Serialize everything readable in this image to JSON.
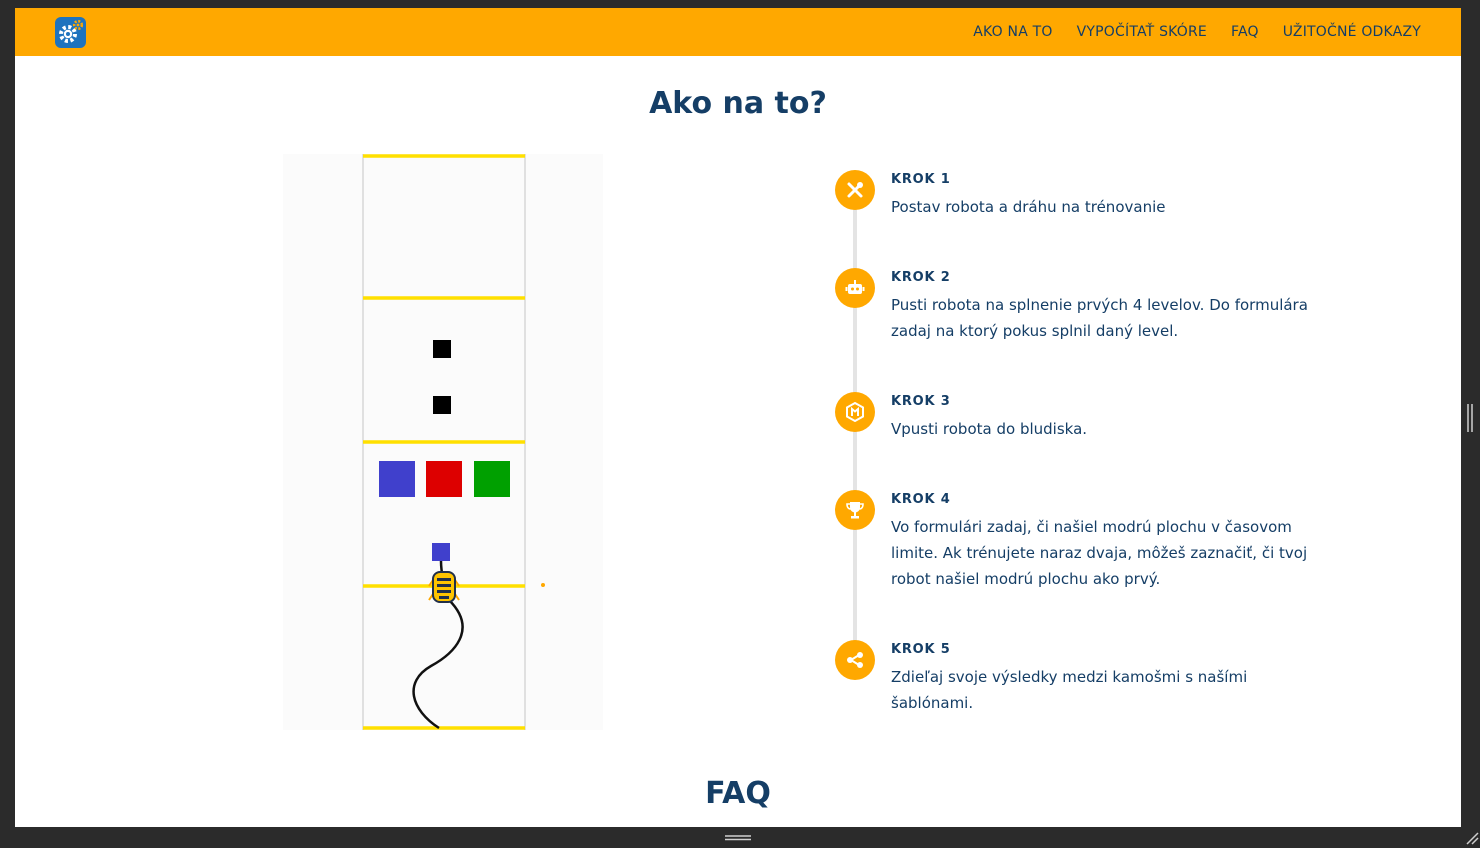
{
  "colors": {
    "navbar": "#ffa800",
    "text": "#153e66",
    "accent": "#ffa800",
    "track_line": "#ffe000",
    "block_blue": "#4040cc",
    "block_red": "#dd0000",
    "block_green": "#00a000",
    "obstacle": "#000000"
  },
  "navbar": {
    "logo_icon": "gears-icon",
    "links": [
      "AKO NA TO",
      "VYPOČÍTAŤ SKÓRE",
      "FAQ",
      "UŽITOČNÉ ODKAZY"
    ]
  },
  "main": {
    "title": "Ako na to?",
    "figure_icon": "robot-track-illustration",
    "steps": [
      {
        "icon": "tools-icon",
        "title": "KROK 1",
        "text": "Postav robota a dráhu na trénovanie"
      },
      {
        "icon": "robot-icon",
        "title": "KROK 2",
        "text": "Pusti robota na splnenie prvých 4 levelov. Do formulára zadaj na ktorý pokus splnil daný level."
      },
      {
        "icon": "maze-icon",
        "title": "KROK 3",
        "text": "Vpusti robota do bludiska."
      },
      {
        "icon": "trophy-icon",
        "title": "KROK 4",
        "text": "Vo formulári zadaj, či našiel modrú plochu v časovom limite. Ak trénujete naraz dvaja, môžeš zaznačiť, či tvoj robot našiel modrú plochu ako prvý."
      },
      {
        "icon": "share-icon",
        "title": "KROK 5",
        "text": "Zdieľaj svoje výsledky medzi kamošmi s našími šablónami."
      }
    ]
  },
  "faq": {
    "title": "FAQ"
  }
}
